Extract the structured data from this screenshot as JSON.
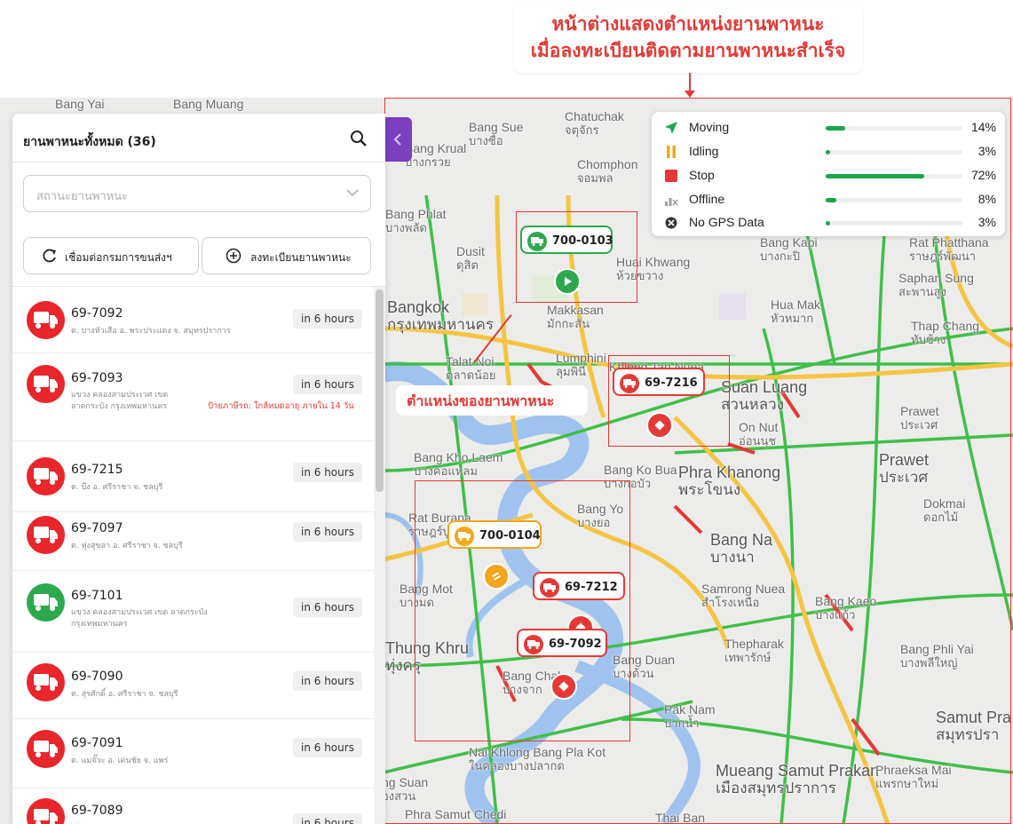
{
  "annotation": {
    "top_line1": "หน้าต่างแสดงตำแหน่งยานพาหนะ",
    "top_line2": "เมื่อลงทะเบียนติดตามยานพาหนะสำเร็จ",
    "vehicle_position": "ตำแหน่งของยานพาหนะ"
  },
  "sidebar": {
    "title": "ยานพาหนะทั้งหมด (36)",
    "status_placeholder": "สถานะยานพาหนะ",
    "connect_button": "เชื่อมต่อกรมการขนส่งฯ",
    "register_button": "ลงทะเบียนยานพาหนะ",
    "vehicles": [
      {
        "plate": "69-7092",
        "address": "ต. บางหัวเสือ อ. พระประแดง จ. สมุทรปราการ",
        "time": "in 6 hours",
        "status": "red",
        "warning": ""
      },
      {
        "plate": "69-7093",
        "address": "แขวง คลองสามประเวศ เขต ลาดกระบัง กรุงเทพมหานคร",
        "time": "in 6 hours",
        "status": "red",
        "warning": "ป้ายภาษีรถ: ใกล้หมดอายุ ภายใน 14 วัน"
      },
      {
        "plate": "69-7215",
        "address": "ต. บึง อ. ศรีราชา จ. ชลบุรี",
        "time": "in 6 hours",
        "status": "red",
        "warning": ""
      },
      {
        "plate": "69-7097",
        "address": "ต. ทุ่งสุขลา อ. ศรีราชา จ. ชลบุรี",
        "time": "in 6 hours",
        "status": "red",
        "warning": ""
      },
      {
        "plate": "69-7101",
        "address": "แขวง คลองสามประเวศ เขต ลาดกระบัง กรุงเทพมหานคร",
        "time": "in 6 hours",
        "status": "green",
        "warning": ""
      },
      {
        "plate": "69-7090",
        "address": "ต. สุรศักดิ์ อ. ศรีราชา จ. ชลบุรี",
        "time": "in 6 hours",
        "status": "red",
        "warning": ""
      },
      {
        "plate": "69-7091",
        "address": "ต. แม่จั๊วะ อ. เด่นชัย จ. แพร่",
        "time": "in 6 hours",
        "status": "red",
        "warning": ""
      },
      {
        "plate": "69-7089",
        "address": "",
        "time": "in 6 hours",
        "status": "red",
        "warning": ""
      }
    ]
  },
  "legend": [
    {
      "label": "Moving",
      "percent": "14%",
      "value": 0.14,
      "icon": "navigation-arrow-icon",
      "color": "#18a84a"
    },
    {
      "label": "Idling",
      "percent": "3%",
      "value": 0.03,
      "icon": "pause-icon",
      "color": "#f3a51b"
    },
    {
      "label": "Stop",
      "percent": "72%",
      "value": 0.72,
      "icon": "stop-square-icon",
      "color": "#e53935"
    },
    {
      "label": "Offline",
      "percent": "8%",
      "value": 0.08,
      "icon": "signal-off-icon",
      "color": "#9e9e9e"
    },
    {
      "label": "No GPS Data",
      "percent": "3%",
      "value": 0.03,
      "icon": "no-gps-icon",
      "color": "#333333"
    }
  ],
  "markers": [
    {
      "plate": "700-0103",
      "status": "green"
    },
    {
      "plate": "69-7216",
      "status": "red"
    },
    {
      "plate": "700-0104",
      "status": "orange"
    },
    {
      "plate": "69-7212",
      "status": "red"
    },
    {
      "plate": "69-7092",
      "status": "red"
    }
  ],
  "places": [
    {
      "en": "Bang Yai",
      "th": ""
    },
    {
      "en": "Bang Muang",
      "th": ""
    },
    {
      "en": "Bang Sue",
      "th": "บางซื่อ"
    },
    {
      "en": "Chatuchak",
      "th": "จตุจักร"
    },
    {
      "en": "Chomphon",
      "th": "จอมพล"
    },
    {
      "en": "Bang Krual",
      "th": "บางกรวย"
    },
    {
      "en": "Bang Phlat",
      "th": "บางพลัด"
    },
    {
      "en": "Dusit",
      "th": "ดุสิต"
    },
    {
      "en": "Huai Khwang",
      "th": "ห้วยขวาง"
    },
    {
      "en": "Bang Kapi",
      "th": "บางกะปิ"
    },
    {
      "en": "Rat Phatthana",
      "th": "ราษฎร์พัฒนา"
    },
    {
      "en": "Saphan Sung",
      "th": "สะพานสูง"
    },
    {
      "en": "Bangkok",
      "th": "กรุงเทพมหานคร"
    },
    {
      "en": "Makkasan",
      "th": "มักกะสัน"
    },
    {
      "en": "Hua Mak",
      "th": "หัวหมาก"
    },
    {
      "en": "Thap Chang",
      "th": "ทับช้าง"
    },
    {
      "en": "Talat Noi",
      "th": "ตลาดน้อย"
    },
    {
      "en": "Lumphini",
      "th": "ลุมพินี"
    },
    {
      "en": "Khlong Tan Nuea",
      "th": ""
    },
    {
      "en": "Suan Luang",
      "th": "สวนหลวง"
    },
    {
      "en": "Prawet",
      "th": "ประเวศ"
    },
    {
      "en": "On Nut",
      "th": "อ่อนนุช"
    },
    {
      "en": "Bang Kho Laem",
      "th": "บางคอแหลม"
    },
    {
      "en": "Bang Ko Bua",
      "th": "บางกอบัว"
    },
    {
      "en": "Phra Khanong",
      "th": "พระโขนง"
    },
    {
      "en": "Dokmai",
      "th": "ดอกไม้"
    },
    {
      "en": "Rat Burana",
      "th": "ราษฎร์บูรณะ"
    },
    {
      "en": "Bang Yo",
      "th": "บางยอ"
    },
    {
      "en": "Bang Na",
      "th": "บางนา"
    },
    {
      "en": "Bang Mot",
      "th": "บางมด"
    },
    {
      "en": "Samrong Nuea",
      "th": "สำโรงเหนือ"
    },
    {
      "en": "Bang Kaeo",
      "th": "บางแก้ว"
    },
    {
      "en": "Thung Khru",
      "th": "ทุ่งครุ"
    },
    {
      "en": "Thepharak",
      "th": "เทพารักษ์"
    },
    {
      "en": "Bang Duan",
      "th": "บางด้วน"
    },
    {
      "en": "Bang Phli Yai",
      "th": "บางพลีใหญ่"
    },
    {
      "en": "Bang Chak",
      "th": "บางจาก"
    },
    {
      "en": "Pak Nam",
      "th": "ปากน้ำ"
    },
    {
      "en": "Samut Pra",
      "th": "สมุทรปรา"
    },
    {
      "en": "Nai Khlong Bang Pla Kot",
      "th": "ในคลองบางปลากด"
    },
    {
      "en": "Mueang Samut Prakan",
      "th": "เมืองสมุทรปราการ"
    },
    {
      "en": "Phraeksa Mai",
      "th": "แพรกษาใหม่"
    },
    {
      "en": "Phra Samut Chedi",
      "th": ""
    },
    {
      "en": "Thai Ban",
      "th": ""
    },
    {
      "en": "ng Suan",
      "th": "องสวน"
    }
  ]
}
